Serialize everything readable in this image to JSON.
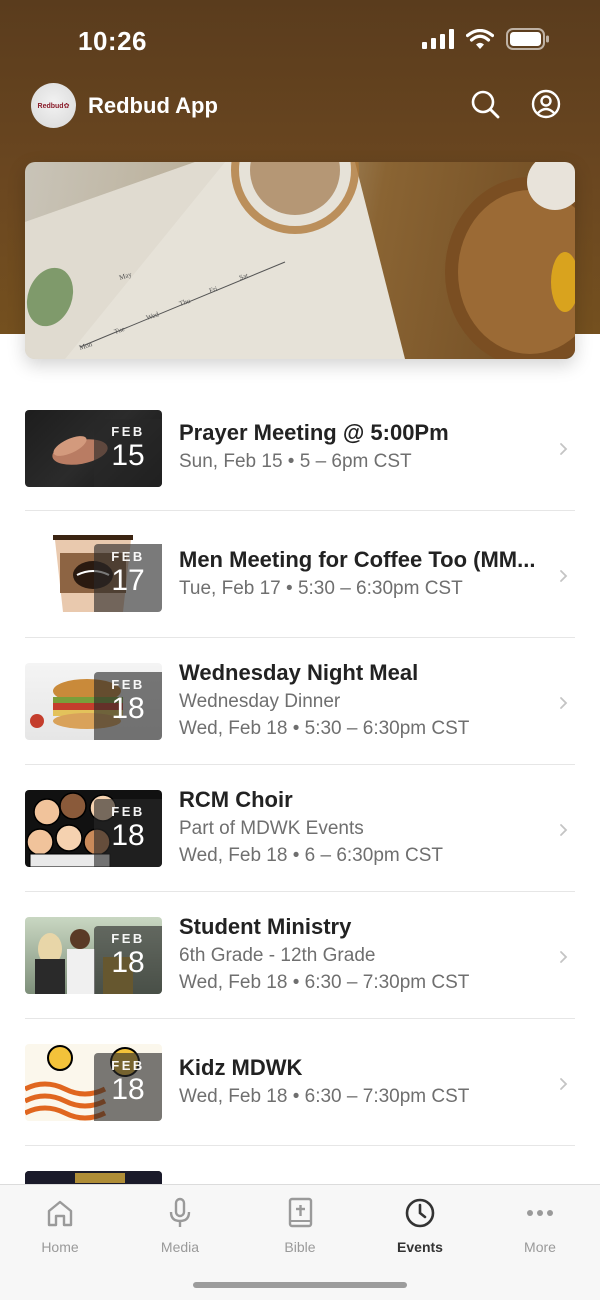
{
  "status_bar": {
    "time": "10:26"
  },
  "app": {
    "title": "Redbud App",
    "logo_text": "Redbud✿"
  },
  "events": [
    {
      "month": "FEB",
      "day": "15",
      "title": "Prayer Meeting @ 5:00Pm",
      "lines": [
        "Sun, Feb 15 • 5 – 6pm CST"
      ]
    },
    {
      "month": "FEB",
      "day": "17",
      "title": "Men Meeting for Coffee Too (MM...",
      "lines": [
        "Tue, Feb 17 • 5:30 – 6:30pm CST"
      ]
    },
    {
      "month": "FEB",
      "day": "18",
      "title": "Wednesday Night Meal",
      "lines": [
        "Wednesday Dinner",
        "Wed, Feb 18 • 5:30 – 6:30pm CST"
      ]
    },
    {
      "month": "FEB",
      "day": "18",
      "title": "RCM Choir",
      "lines": [
        "Part of MDWK Events",
        "Wed, Feb 18 • 6 – 6:30pm CST"
      ]
    },
    {
      "month": "FEB",
      "day": "18",
      "title": "Student Ministry",
      "lines": [
        "6th Grade - 12th Grade",
        "Wed, Feb 18 • 6:30 – 7:30pm CST"
      ]
    },
    {
      "month": "FEB",
      "day": "18",
      "title": "Kidz MDWK",
      "lines": [
        "Wed, Feb 18 • 6:30 – 7:30pm CST"
      ]
    }
  ],
  "tabs": [
    {
      "label": "Home",
      "icon": "home-icon",
      "active": false
    },
    {
      "label": "Media",
      "icon": "microphone-icon",
      "active": false
    },
    {
      "label": "Bible",
      "icon": "bible-icon",
      "active": false
    },
    {
      "label": "Events",
      "icon": "clock-icon",
      "active": true
    },
    {
      "label": "More",
      "icon": "more-icon",
      "active": false
    }
  ],
  "colors": {
    "header": "#6b4720",
    "accent": "#333333",
    "muted": "#9a9a9a"
  }
}
